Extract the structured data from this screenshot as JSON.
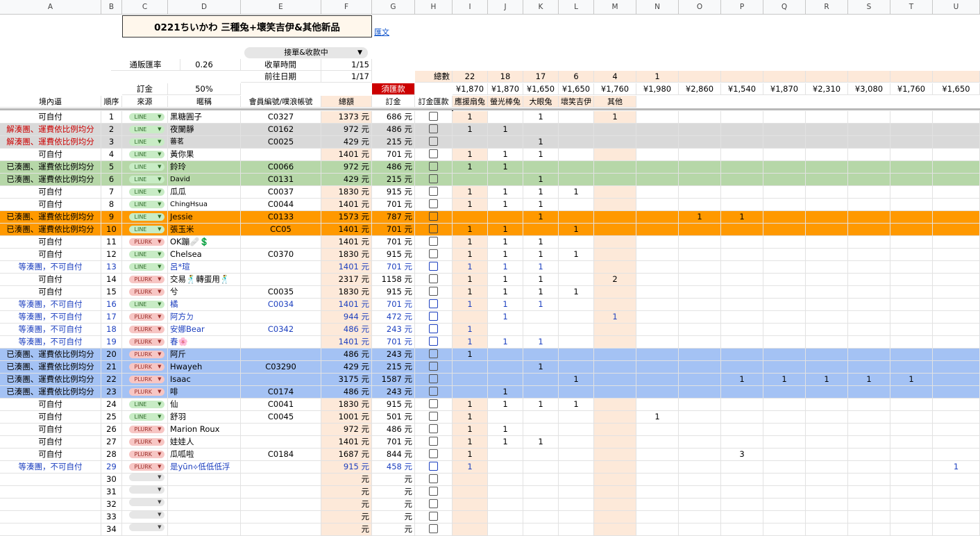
{
  "title": "0221ちいかわ 三種兔+壞笑吉伊&其他新品",
  "link_text": "匯文",
  "dropdown_value": "接單&收款中",
  "labels": {
    "rate_label": "通販匯率",
    "rate_value": "0.26",
    "deadline_label": "收單時間",
    "deadline_value": "1/15",
    "go_label": "前往日期",
    "go_value": "1/17",
    "total_label": "總數",
    "deposit_label": "訂金",
    "deposit_value": "50%",
    "must_pay": "須匯款"
  },
  "column_letters": [
    "A",
    "B",
    "C",
    "D",
    "E",
    "F",
    "G",
    "H",
    "I",
    "J",
    "K",
    "L",
    "M",
    "N",
    "O",
    "P",
    "Q",
    "R",
    "S",
    "T",
    "U"
  ],
  "totals": [
    "22",
    "18",
    "17",
    "6",
    "4",
    "1"
  ],
  "prices": [
    "¥1,870",
    "¥1,870",
    "¥1,650",
    "¥1,650",
    "¥1,760",
    "¥1,980",
    "¥2,860",
    "¥1,540",
    "¥1,870",
    "¥2,310",
    "¥3,080",
    "¥1,760",
    "¥1,650"
  ],
  "headers": [
    "境內逼",
    "順序",
    "來源",
    "暱稱",
    "會員編號/噗浪帳號",
    "總額",
    "訂金",
    "訂金匯款",
    "應援扇兔",
    "螢光棒兔",
    "大眼兔",
    "壞笑吉伊",
    "其他"
  ],
  "rows": [
    {
      "status": "可自付",
      "no": "1",
      "src": "LINE",
      "nick": "黑糖圓子",
      "member": "C0327",
      "total": "1373 元",
      "dep": "686 元",
      "v": {
        "I": "1",
        "K": "1",
        "M": "1"
      },
      "color": "normal"
    },
    {
      "status": "解湊團、運費依比例均分",
      "no": "2",
      "src": "LINE",
      "nick": "夜闌靜",
      "member": "C0162",
      "total": "972 元",
      "dep": "486 元",
      "v": {
        "I": "1",
        "J": "1"
      },
      "color": "gray"
    },
    {
      "status": "解湊團、運費依比例均分",
      "no": "3",
      "src": "LINE",
      "nick": "蕃茗",
      "member": "C0025",
      "total": "429 元",
      "dep": "215 元",
      "v": {
        "K": "1"
      },
      "color": "gray"
    },
    {
      "status": "可自付",
      "no": "4",
      "src": "LINE",
      "nick": "黃你果",
      "member": "",
      "total": "1401 元",
      "dep": "701 元",
      "v": {
        "I": "1",
        "J": "1",
        "K": "1"
      },
      "color": "normal"
    },
    {
      "status": "已湊團、運費依比例均分",
      "no": "5",
      "src": "LINE",
      "nick": "鈴玲",
      "member": "C0066",
      "total": "972 元",
      "dep": "486 元",
      "v": {
        "I": "1",
        "J": "1"
      },
      "color": "green"
    },
    {
      "status": "已湊團、運費依比例均分",
      "no": "6",
      "src": "LINE",
      "nick": "David",
      "member": "C0131",
      "total": "429 元",
      "dep": "215 元",
      "v": {
        "K": "1"
      },
      "color": "green"
    },
    {
      "status": "可自付",
      "no": "7",
      "src": "LINE",
      "nick": "瓜瓜",
      "member": "C0037",
      "total": "1830 元",
      "dep": "915 元",
      "v": {
        "I": "1",
        "J": "1",
        "K": "1",
        "L": "1"
      },
      "color": "normal"
    },
    {
      "status": "可自付",
      "no": "8",
      "src": "LINE",
      "nick": "ChingHsua",
      "member": "C0044",
      "total": "1401 元",
      "dep": "701 元",
      "v": {
        "I": "1",
        "J": "1",
        "K": "1"
      },
      "color": "normal"
    },
    {
      "status": "已湊團、運費依比例均分",
      "no": "9",
      "src": "LINE",
      "nick": "Jessie",
      "member": "C0133",
      "total": "1573 元",
      "dep": "787 元",
      "v": {
        "K": "1",
        "O": "1",
        "P": "1"
      },
      "color": "orange"
    },
    {
      "status": "已湊團、運費依比例均分",
      "no": "10",
      "src": "LINE",
      "nick": "張玉米",
      "member": "CC05",
      "total": "1401 元",
      "dep": "701 元",
      "v": {
        "I": "1",
        "J": "1",
        "L": "1"
      },
      "color": "orange"
    },
    {
      "status": "可自付",
      "no": "11",
      "src": "PLURK",
      "nick": "OK蹦🩹💲",
      "member": "",
      "total": "1401 元",
      "dep": "701 元",
      "v": {
        "I": "1",
        "J": "1",
        "K": "1"
      },
      "color": "normal"
    },
    {
      "status": "可自付",
      "no": "12",
      "src": "LINE",
      "nick": "Chelsea",
      "member": "C0370",
      "total": "1830 元",
      "dep": "915 元",
      "v": {
        "I": "1",
        "J": "1",
        "K": "1",
        "L": "1"
      },
      "color": "normal"
    },
    {
      "status": "等湊團，不可自付",
      "no": "13",
      "src": "LINE",
      "nick": "呂*瑄",
      "member": "",
      "total": "1401 元",
      "dep": "701 元",
      "v": {
        "I": "1",
        "J": "1",
        "K": "1"
      },
      "color": "blue"
    },
    {
      "status": "可自付",
      "no": "14",
      "src": "PLURK",
      "nick": "交易🕺轉蛋用🕺",
      "member": "",
      "total": "2317 元",
      "dep": "1158 元",
      "v": {
        "I": "1",
        "J": "1",
        "K": "1",
        "M": "2"
      },
      "color": "normal"
    },
    {
      "status": "可自付",
      "no": "15",
      "src": "PLURK",
      "nick": "兮",
      "member": "C0035",
      "total": "1830 元",
      "dep": "915 元",
      "v": {
        "I": "1",
        "J": "1",
        "K": "1",
        "L": "1"
      },
      "color": "normal"
    },
    {
      "status": "等湊團，不可自付",
      "no": "16",
      "src": "LINE",
      "nick": "橘",
      "member": "C0034",
      "total": "1401 元",
      "dep": "701 元",
      "v": {
        "I": "1",
        "J": "1",
        "K": "1"
      },
      "color": "blue"
    },
    {
      "status": "等湊團，不可自付",
      "no": "17",
      "src": "PLURK",
      "nick": "阿方ㄉ",
      "member": "",
      "total": "944 元",
      "dep": "472 元",
      "v": {
        "J": "1",
        "M": "1"
      },
      "color": "blue"
    },
    {
      "status": "等湊團，不可自付",
      "no": "18",
      "src": "PLURK",
      "nick": "安娜Bear",
      "member": "C0342",
      "total": "486 元",
      "dep": "243 元",
      "v": {
        "I": "1"
      },
      "color": "blue"
    },
    {
      "status": "等湊團，不可自付",
      "no": "19",
      "src": "PLURK",
      "nick": "春🌸",
      "member": "",
      "total": "1401 元",
      "dep": "701 元",
      "v": {
        "I": "1",
        "J": "1",
        "K": "1"
      },
      "color": "blue"
    },
    {
      "status": "已湊團、運費依比例均分",
      "no": "20",
      "src": "PLURK",
      "nick": "阿斤",
      "member": "",
      "total": "486 元",
      "dep": "243 元",
      "v": {
        "I": "1"
      },
      "color": "lblue"
    },
    {
      "status": "已湊團、運費依比例均分",
      "no": "21",
      "src": "PLURK",
      "nick": "Hwayeh",
      "member": "C03290",
      "total": "429 元",
      "dep": "215 元",
      "v": {
        "K": "1"
      },
      "color": "lblue"
    },
    {
      "status": "已湊團、運費依比例均分",
      "no": "22",
      "src": "PLURK",
      "nick": "Isaac",
      "member": "",
      "total": "3175 元",
      "dep": "1587 元",
      "v": {
        "L": "1",
        "P": "1",
        "Q": "1",
        "R": "1",
        "S": "1",
        "T": "1"
      },
      "color": "lblue"
    },
    {
      "status": "已湊團、運費依比例均分",
      "no": "23",
      "src": "PLURK",
      "nick": "啡",
      "member": "C0174",
      "total": "486 元",
      "dep": "243 元",
      "v": {
        "J": "1"
      },
      "color": "lblue"
    },
    {
      "status": "可自付",
      "no": "24",
      "src": "LINE",
      "nick": "仙",
      "member": "C0041",
      "total": "1830 元",
      "dep": "915 元",
      "v": {
        "I": "1",
        "J": "1",
        "K": "1",
        "L": "1"
      },
      "color": "normal"
    },
    {
      "status": "可自付",
      "no": "25",
      "src": "LINE",
      "nick": "舒羽",
      "member": "C0045",
      "total": "1001 元",
      "dep": "501 元",
      "v": {
        "I": "1",
        "N": "1"
      },
      "color": "normal"
    },
    {
      "status": "可自付",
      "no": "26",
      "src": "PLURK",
      "nick": "Marion Roux",
      "member": "",
      "total": "972 元",
      "dep": "486 元",
      "v": {
        "I": "1",
        "J": "1"
      },
      "color": "normal"
    },
    {
      "status": "可自付",
      "no": "27",
      "src": "PLURK",
      "nick": "娃娃人",
      "member": "",
      "total": "1401 元",
      "dep": "701 元",
      "v": {
        "I": "1",
        "J": "1",
        "K": "1"
      },
      "color": "normal"
    },
    {
      "status": "可自付",
      "no": "28",
      "src": "PLURK",
      "nick": "瓜呱啦",
      "member": "C0184",
      "total": "1687 元",
      "dep": "844 元",
      "v": {
        "I": "1",
        "P": "3"
      },
      "color": "normal"
    },
    {
      "status": "等湊團，不可自付",
      "no": "29",
      "src": "PLURK",
      "nick": "是yūn⟡低低低浮",
      "member": "",
      "total": "915 元",
      "dep": "458 元",
      "v": {
        "I": "1",
        "U": "1"
      },
      "color": "blue"
    },
    {
      "status": "",
      "no": "30",
      "src": "",
      "nick": "",
      "member": "",
      "total": "元",
      "dep": "元",
      "v": {},
      "color": "empty"
    },
    {
      "status": "",
      "no": "31",
      "src": "",
      "nick": "",
      "member": "",
      "total": "元",
      "dep": "元",
      "v": {},
      "color": "empty"
    },
    {
      "status": "",
      "no": "32",
      "src": "",
      "nick": "",
      "member": "",
      "total": "元",
      "dep": "元",
      "v": {},
      "color": "empty"
    },
    {
      "status": "",
      "no": "33",
      "src": "",
      "nick": "",
      "member": "",
      "total": "元",
      "dep": "元",
      "v": {},
      "color": "empty"
    },
    {
      "status": "",
      "no": "34",
      "src": "",
      "nick": "",
      "member": "",
      "total": "元",
      "dep": "元",
      "v": {},
      "color": "empty"
    }
  ],
  "colors": {
    "gray_row": "#d9d9d9",
    "green_row": "#b6d7a8",
    "orange_row": "#ff9900",
    "lblue_row": "#a4c2f4",
    "peach": "#fde9d9",
    "must_pay": "#cc0000",
    "gray_text": "#cc0000",
    "blue_text": "#1c3fbf"
  }
}
